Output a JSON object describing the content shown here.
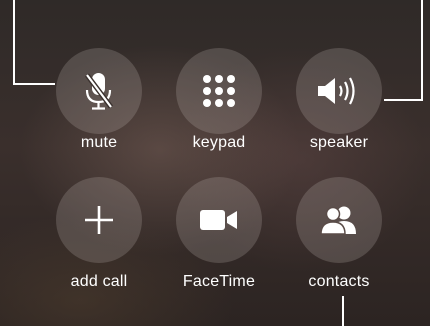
{
  "controls": [
    {
      "id": "mute",
      "label": "mute",
      "icon": "mic-slash-icon"
    },
    {
      "id": "keypad",
      "label": "keypad",
      "icon": "keypad-grid-icon"
    },
    {
      "id": "speaker",
      "label": "speaker",
      "icon": "speaker-icon"
    },
    {
      "id": "add-call",
      "label": "add call",
      "icon": "plus-icon"
    },
    {
      "id": "facetime",
      "label": "FaceTime",
      "icon": "video-camera-icon"
    },
    {
      "id": "contacts",
      "label": "contacts",
      "icon": "contacts-icon"
    }
  ],
  "colors": {
    "button_fill": "rgba(200,190,185,0.22)",
    "icon": "#ffffff",
    "text": "#ffffff",
    "callout_lines": "#ffffff"
  }
}
